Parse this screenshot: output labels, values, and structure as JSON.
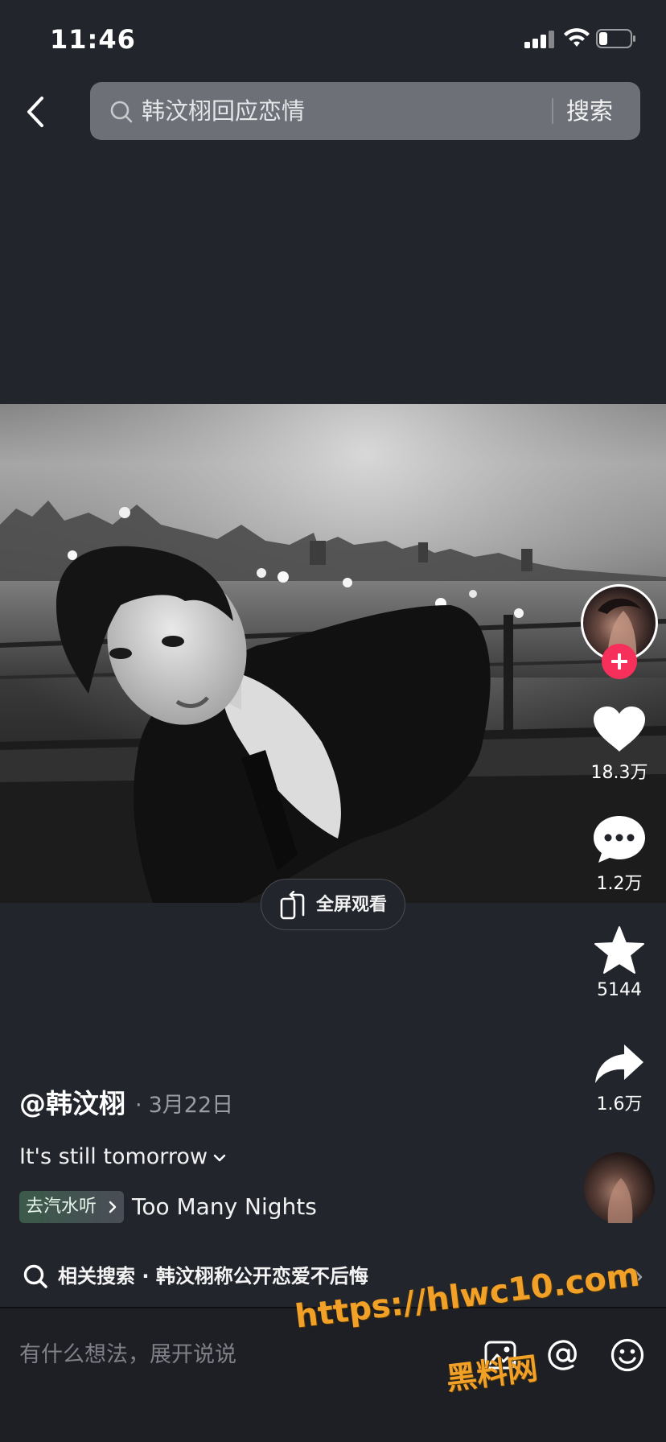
{
  "status_bar": {
    "time": "11:46",
    "icons": [
      "signal-icon",
      "wifi-icon",
      "battery-icon"
    ]
  },
  "header": {
    "search_query": "韩汶栩回应恋情",
    "search_button": "搜索",
    "icons": [
      "back-icon",
      "search-icon"
    ]
  },
  "video": {
    "fullscreen_label": "全屏观看"
  },
  "actions": {
    "likes": "18.3万",
    "comments": "1.2万",
    "favorites": "5144",
    "shares": "1.6万",
    "icons": [
      "heart-icon",
      "comment-icon",
      "star-icon",
      "share-icon",
      "plus-icon"
    ]
  },
  "post": {
    "author": "@韩汶栩",
    "date_separator": "·",
    "date": "3月22日",
    "caption": "It's still tomorrow",
    "music_tag": "去汽水听",
    "music_title": "Too Many Nights"
  },
  "related": {
    "text": "相关搜索 · 韩汶栩称公开恋爱不后悔"
  },
  "comment_bar": {
    "placeholder": "有什么想法，展开说说",
    "icons": [
      "image-icon",
      "at-icon",
      "emoji-icon"
    ]
  },
  "watermark": {
    "url": "https://hlwc10.com",
    "name": "黑料网"
  },
  "colors": {
    "background": "#23252c",
    "follow_accent": "#f6305a",
    "watermark": "#f2a128"
  }
}
